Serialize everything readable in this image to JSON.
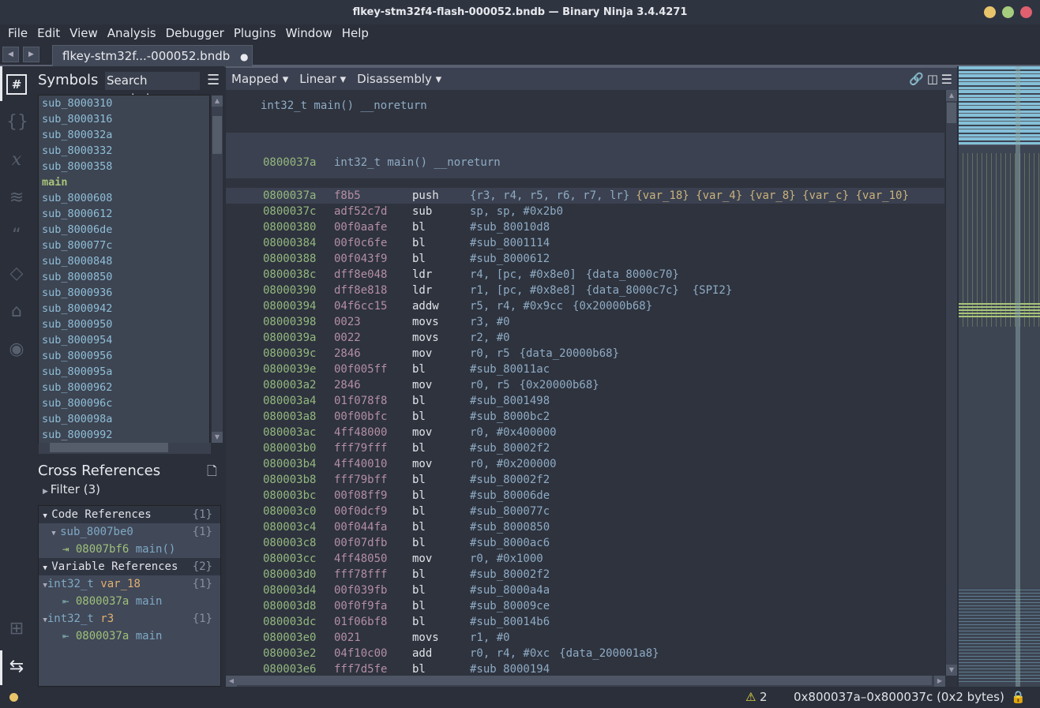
{
  "window": {
    "title": "flkey-stm32f4-flash-000052.bndb — Binary Ninja 3.4.4271"
  },
  "menu": [
    "File",
    "Edit",
    "View",
    "Analysis",
    "Debugger",
    "Plugins",
    "Window",
    "Help"
  ],
  "tab": {
    "label": "flkey-stm32f...-000052.bndb",
    "modified_dot": "●"
  },
  "symbols": {
    "title": "Symbols",
    "search_placeholder": "Search symbols",
    "items": [
      "sub_8000310",
      "sub_8000316",
      "sub_800032a",
      "sub_8000332",
      "sub_8000358",
      "main",
      "sub_8000608",
      "sub_8000612",
      "sub_80006de",
      "sub_800077c",
      "sub_8000848",
      "sub_8000850",
      "sub_8000936",
      "sub_8000942",
      "sub_8000950",
      "sub_8000954",
      "sub_8000956",
      "sub_800095a",
      "sub_8000962",
      "sub_800096c",
      "sub_800098a",
      "sub_8000992"
    ],
    "selected": "main"
  },
  "xrefs": {
    "title": "Cross References",
    "filter": "Filter (3)",
    "code_refs": {
      "label": "Code References",
      "count": "{1}"
    },
    "code_func": {
      "label": "sub_8007be0",
      "count": "{1}"
    },
    "code_item": {
      "addr": "08007bf6",
      "name": "main()"
    },
    "var_refs": {
      "label": "Variable References",
      "count": "{2}"
    },
    "var1": {
      "type": "int32_t",
      "name": "var_18",
      "count": "{1}",
      "addr": "0800037a",
      "func": "main"
    },
    "var2": {
      "type": "int32_t",
      "name": "r3",
      "count": "{1}",
      "addr": "0800037a",
      "func": "main"
    }
  },
  "viewbar": {
    "mapped": "Mapped ▾",
    "linear": "Linear ▾",
    "disassembly": "Disassembly ▾"
  },
  "disasm": {
    "header_sig": "int32_t main() __noreturn",
    "func_addr": "0800037a",
    "func_sig": "int32_t main() __noreturn",
    "rows": [
      [
        "0800037a",
        "f8b5",
        "push",
        "{r3, r4, r5, r6, r7, lr}",
        "{var_18} {var_4} {var_8} {var_c} {var_10}"
      ],
      [
        "0800037c",
        "adf52c7d",
        "sub",
        "sp, sp, #0x2b0",
        ""
      ],
      [
        "08000380",
        "00f0aafe",
        "bl",
        "#sub_80010d8",
        ""
      ],
      [
        "08000384",
        "00f0c6fe",
        "bl",
        "#sub_8001114",
        ""
      ],
      [
        "08000388",
        "00f043f9",
        "bl",
        "#sub_8000612",
        ""
      ],
      [
        "0800038c",
        "dff8e048",
        "ldr",
        "r4, [pc, #0x8e0]",
        "{data_8000c70}"
      ],
      [
        "08000390",
        "dff8e818",
        "ldr",
        "r1, [pc, #0x8e8]",
        "{data_8000c7c}  {SPI2}"
      ],
      [
        "08000394",
        "04f6cc15",
        "addw",
        "r5, r4, #0x9cc",
        "{0x20000b68}"
      ],
      [
        "08000398",
        "0023",
        "movs",
        "r3, #0",
        ""
      ],
      [
        "0800039a",
        "0022",
        "movs",
        "r2, #0",
        ""
      ],
      [
        "0800039c",
        "2846",
        "mov",
        "r0, r5",
        "{data_20000b68}"
      ],
      [
        "0800039e",
        "00f005ff",
        "bl",
        "#sub_80011ac",
        ""
      ],
      [
        "080003a2",
        "2846",
        "mov",
        "r0, r5",
        "{0x20000b68}"
      ],
      [
        "080003a4",
        "01f078f8",
        "bl",
        "#sub_8001498",
        ""
      ],
      [
        "080003a8",
        "00f00bfc",
        "bl",
        "#sub_8000bc2",
        ""
      ],
      [
        "080003ac",
        "4ff48000",
        "mov",
        "r0, #0x400000",
        ""
      ],
      [
        "080003b0",
        "fff79fff",
        "bl",
        "#sub_80002f2",
        ""
      ],
      [
        "080003b4",
        "4ff40010",
        "mov",
        "r0, #0x200000",
        ""
      ],
      [
        "080003b8",
        "fff79bff",
        "bl",
        "#sub_80002f2",
        ""
      ],
      [
        "080003bc",
        "00f08ff9",
        "bl",
        "#sub_80006de",
        ""
      ],
      [
        "080003c0",
        "00f0dcf9",
        "bl",
        "#sub_800077c",
        ""
      ],
      [
        "080003c4",
        "00f044fa",
        "bl",
        "#sub_8000850",
        ""
      ],
      [
        "080003c8",
        "00f07dfb",
        "bl",
        "#sub_8000ac6",
        ""
      ],
      [
        "080003cc",
        "4ff48050",
        "mov",
        "r0, #0x1000",
        ""
      ],
      [
        "080003d0",
        "fff78fff",
        "bl",
        "#sub_80002f2",
        ""
      ],
      [
        "080003d4",
        "00f039fb",
        "bl",
        "#sub_8000a4a",
        ""
      ],
      [
        "080003d8",
        "00f0f9fa",
        "bl",
        "#sub_80009ce",
        ""
      ],
      [
        "080003dc",
        "01f06bf8",
        "bl",
        "#sub_80014b6",
        ""
      ],
      [
        "080003e0",
        "0021",
        "movs",
        "r1, #0",
        ""
      ],
      [
        "080003e2",
        "04f10c00",
        "add",
        "r0, r4, #0xc",
        "{data_200001a8}"
      ],
      [
        "080003e6",
        "fff7d5fe",
        "bl",
        "#sub_8000194",
        ""
      ]
    ]
  },
  "status": {
    "warning_count": "2",
    "selection": "0x800037a–0x800037c (0x2 bytes)"
  },
  "colors": {
    "address": "#94b87e",
    "bytes": "#b58ea4",
    "operand": "#8fabc4",
    "number": "#c690a8",
    "selected_symbol": "#a8c47a"
  }
}
